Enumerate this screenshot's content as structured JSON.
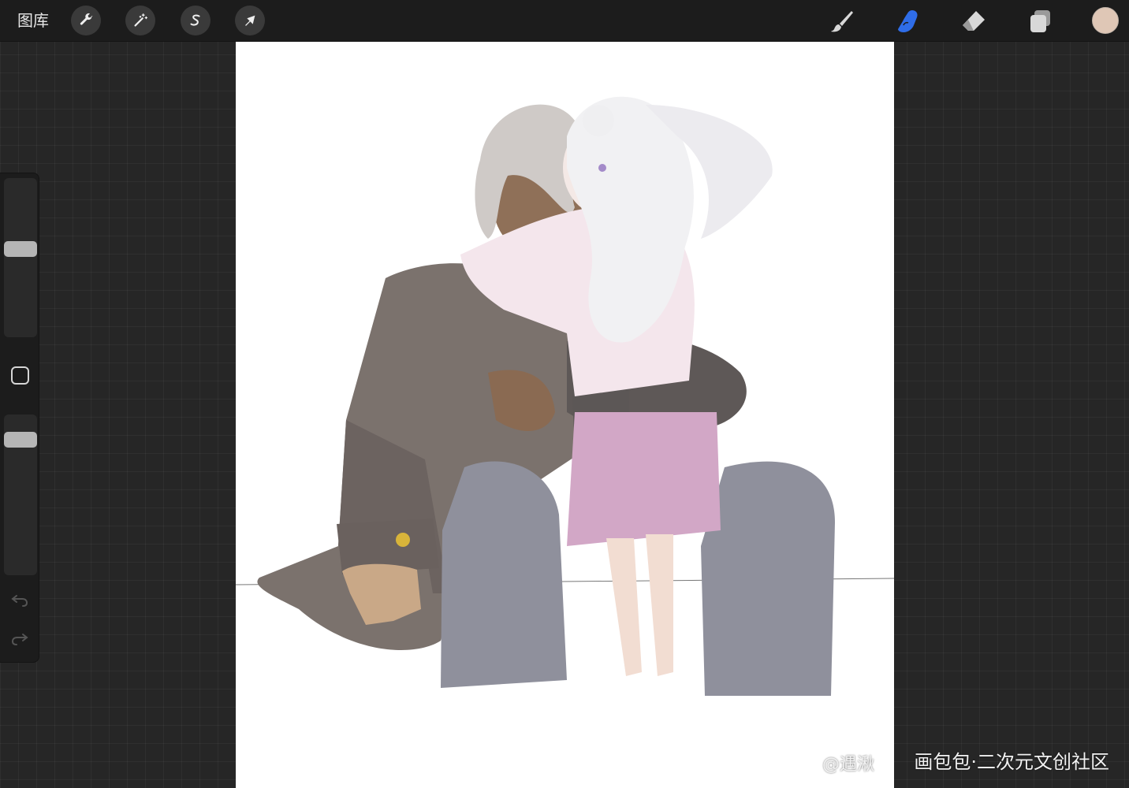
{
  "topbar": {
    "gallery_label": "图库",
    "left_tools": [
      {
        "name": "actions",
        "icon": "wrench-icon"
      },
      {
        "name": "adjustments",
        "icon": "magic-wand-icon"
      },
      {
        "name": "selection",
        "icon": "selection-s-icon"
      },
      {
        "name": "transform",
        "icon": "arrow-cursor-icon"
      }
    ],
    "right_tools": [
      {
        "name": "brush",
        "icon": "brush-icon",
        "active": false
      },
      {
        "name": "smudge",
        "icon": "smudge-finger-icon",
        "active": true
      },
      {
        "name": "eraser",
        "icon": "eraser-icon",
        "active": false
      },
      {
        "name": "layers",
        "icon": "layers-icon",
        "active": false
      }
    ],
    "current_color": "#dfc7b6",
    "active_color": "#2f6de8"
  },
  "sidebar": {
    "brush_size_level": 0.56,
    "opacity_level": 0.88
  },
  "watermark": {
    "user": "@遇湫",
    "site": "画包包·二次元文创社区"
  }
}
